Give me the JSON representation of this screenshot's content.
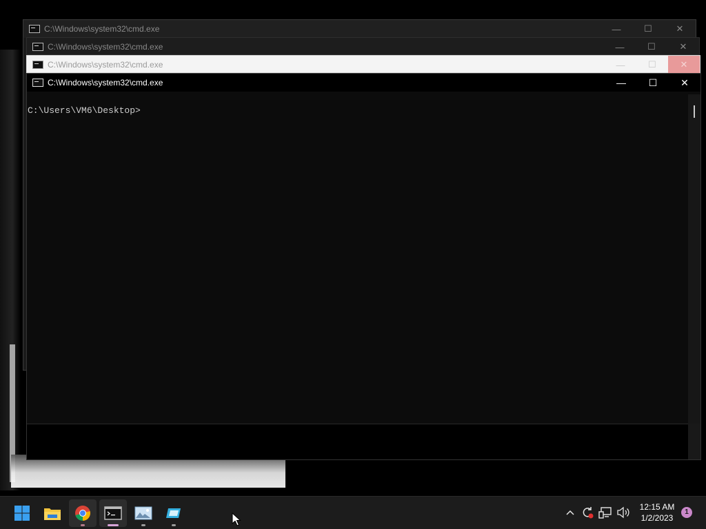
{
  "windows": [
    {
      "title": "C:\\Windows\\system32\\cmd.exe"
    },
    {
      "title": "C:\\Windows\\system32\\cmd.exe"
    },
    {
      "title": "C:\\Windows\\system32\\cmd.exe"
    },
    {
      "title": "C:\\Windows\\system32\\cmd.exe"
    }
  ],
  "console": {
    "prompt": "C:\\Users\\VM6\\Desktop>"
  },
  "controls": {
    "minimize": "—",
    "maximize": "☐",
    "close": "✕"
  },
  "taskbar": {
    "items": [
      {
        "icon": "windows-start-icon"
      },
      {
        "icon": "file-explorer-icon"
      },
      {
        "icon": "chrome-icon"
      },
      {
        "icon": "terminal-icon"
      },
      {
        "icon": "image-viewer-icon"
      },
      {
        "icon": "app-icon"
      }
    ]
  },
  "tray": {
    "icons": [
      "chevron-up-icon",
      "sync-icon",
      "network-icon",
      "volume-icon"
    ],
    "time": "12:15 AM",
    "date": "1/2/2023",
    "notification_count": "1"
  }
}
